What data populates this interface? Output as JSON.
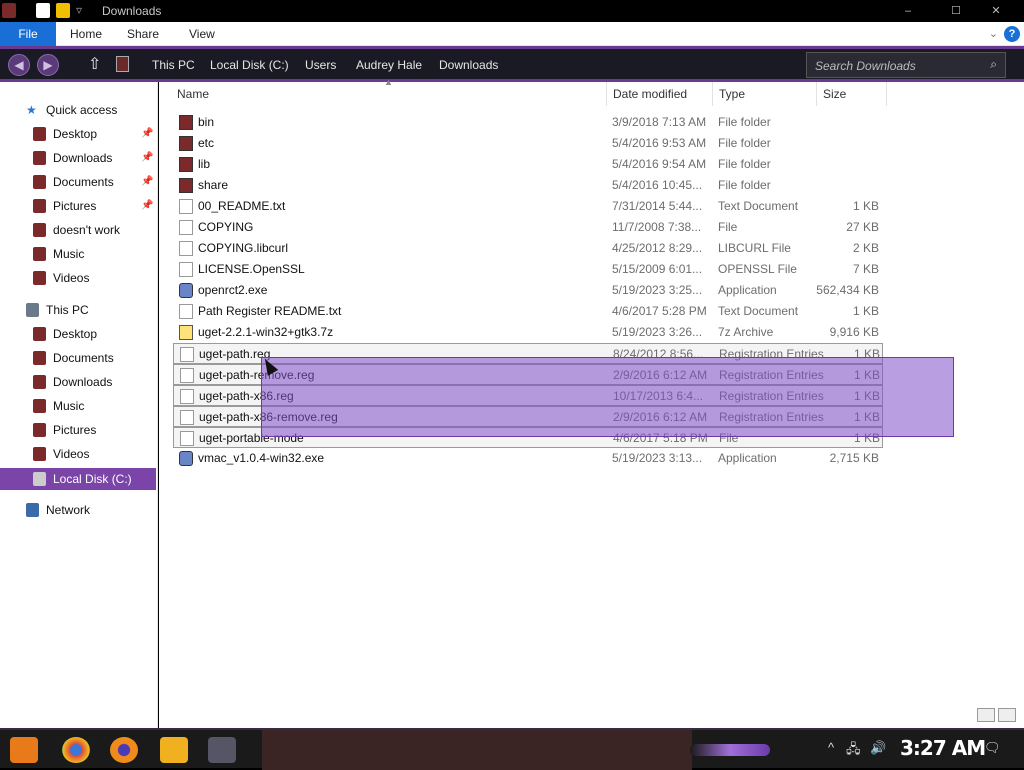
{
  "window": {
    "title": "Downloads",
    "controls": {
      "minimize": "–",
      "maximize": "☐",
      "close": "✕"
    }
  },
  "ribbon": {
    "tabs": [
      "File",
      "Home",
      "Share",
      "View"
    ],
    "help": "?",
    "expand": "⌄"
  },
  "nav": {
    "back": "◀",
    "forward": "▶",
    "up": "⇧",
    "breadcrumbs": [
      "This PC",
      "Local Disk (C:)",
      "Users",
      "Audrey Hale",
      "Downloads"
    ],
    "search_placeholder": "Search Downloads",
    "search_icon": "⌕"
  },
  "sidebar": {
    "quick_access": "Quick access",
    "quick_items": [
      {
        "label": "Desktop",
        "pinned": true
      },
      {
        "label": "Downloads",
        "pinned": true
      },
      {
        "label": "Documents",
        "pinned": true
      },
      {
        "label": "Pictures",
        "pinned": true
      },
      {
        "label": "doesn't work",
        "pinned": false
      },
      {
        "label": "Music",
        "pinned": false
      },
      {
        "label": "Videos",
        "pinned": false
      }
    ],
    "this_pc": "This PC",
    "pc_items": [
      "Desktop",
      "Documents",
      "Downloads",
      "Music",
      "Pictures",
      "Videos",
      "Local Disk (C:)"
    ],
    "selected": "Local Disk (C:)",
    "network": "Network",
    "pin_glyph": "📌"
  },
  "columns": {
    "name": "Name",
    "date": "Date modified",
    "type": "Type",
    "size": "Size"
  },
  "files": [
    {
      "name": "bin",
      "date": "3/9/2018 7:13 AM",
      "type": "File folder",
      "size": "",
      "icon": "folder"
    },
    {
      "name": "etc",
      "date": "5/4/2016 9:53 AM",
      "type": "File folder",
      "size": "",
      "icon": "folder"
    },
    {
      "name": "lib",
      "date": "5/4/2016 9:54 AM",
      "type": "File folder",
      "size": "",
      "icon": "folder"
    },
    {
      "name": "share",
      "date": "5/4/2016 10:45...",
      "type": "File folder",
      "size": "",
      "icon": "folder"
    },
    {
      "name": "00_README.txt",
      "date": "7/31/2014 5:44...",
      "type": "Text Document",
      "size": "1 KB",
      "icon": "txt"
    },
    {
      "name": "COPYING",
      "date": "11/7/2008 7:38...",
      "type": "File",
      "size": "27 KB",
      "icon": "txt"
    },
    {
      "name": "COPYING.libcurl",
      "date": "4/25/2012 8:29...",
      "type": "LIBCURL File",
      "size": "2 KB",
      "icon": "txt"
    },
    {
      "name": "LICENSE.OpenSSL",
      "date": "5/15/2009 6:01...",
      "type": "OPENSSL File",
      "size": "7 KB",
      "icon": "txt"
    },
    {
      "name": "openrct2.exe",
      "date": "5/19/2023 3:25...",
      "type": "Application",
      "size": "562,434 KB",
      "icon": "exe"
    },
    {
      "name": "Path Register README.txt",
      "date": "4/6/2017 5:28 PM",
      "type": "Text Document",
      "size": "1 KB",
      "icon": "txt"
    },
    {
      "name": "uget-2.2.1-win32+gtk3.7z",
      "date": "5/19/2023 3:26...",
      "type": "7z Archive",
      "size": "9,916 KB",
      "icon": "7z"
    },
    {
      "name": "uget-path.reg",
      "date": "8/24/2012 8:56...",
      "type": "Registration Entries",
      "size": "1 KB",
      "icon": "txt",
      "highlighted": true
    },
    {
      "name": "uget-path-remove.reg",
      "date": "2/9/2016 6:12 AM",
      "type": "Registration Entries",
      "size": "1 KB",
      "icon": "txt",
      "highlighted": true
    },
    {
      "name": "uget-path-x86.reg",
      "date": "10/17/2013 6:4...",
      "type": "Registration Entries",
      "size": "1 KB",
      "icon": "txt",
      "highlighted": true
    },
    {
      "name": "uget-path-x86-remove.reg",
      "date": "2/9/2016 6:12 AM",
      "type": "Registration Entries",
      "size": "1 KB",
      "icon": "txt",
      "highlighted": true
    },
    {
      "name": "uget-portable-mode",
      "date": "4/6/2017 5:18 PM",
      "type": "File",
      "size": "1 KB",
      "icon": "txt",
      "highlighted": true
    },
    {
      "name": "vmac_v1.0.4-win32.exe",
      "date": "5/19/2023 3:13...",
      "type": "Application",
      "size": "2,715 KB",
      "icon": "exe"
    }
  ],
  "taskbar": {
    "apps": [
      "start-icon",
      "chrome-icon",
      "firefox-icon",
      "file-explorer-icon",
      "app-icon"
    ],
    "tray": [
      "^",
      "🖧",
      "🔊"
    ],
    "clock": "3:27 AM",
    "notification": "🗨"
  },
  "colors": {
    "accent": "#7a44a8",
    "file_tab": "#1a6fd6",
    "marquee": "#8050c8"
  }
}
